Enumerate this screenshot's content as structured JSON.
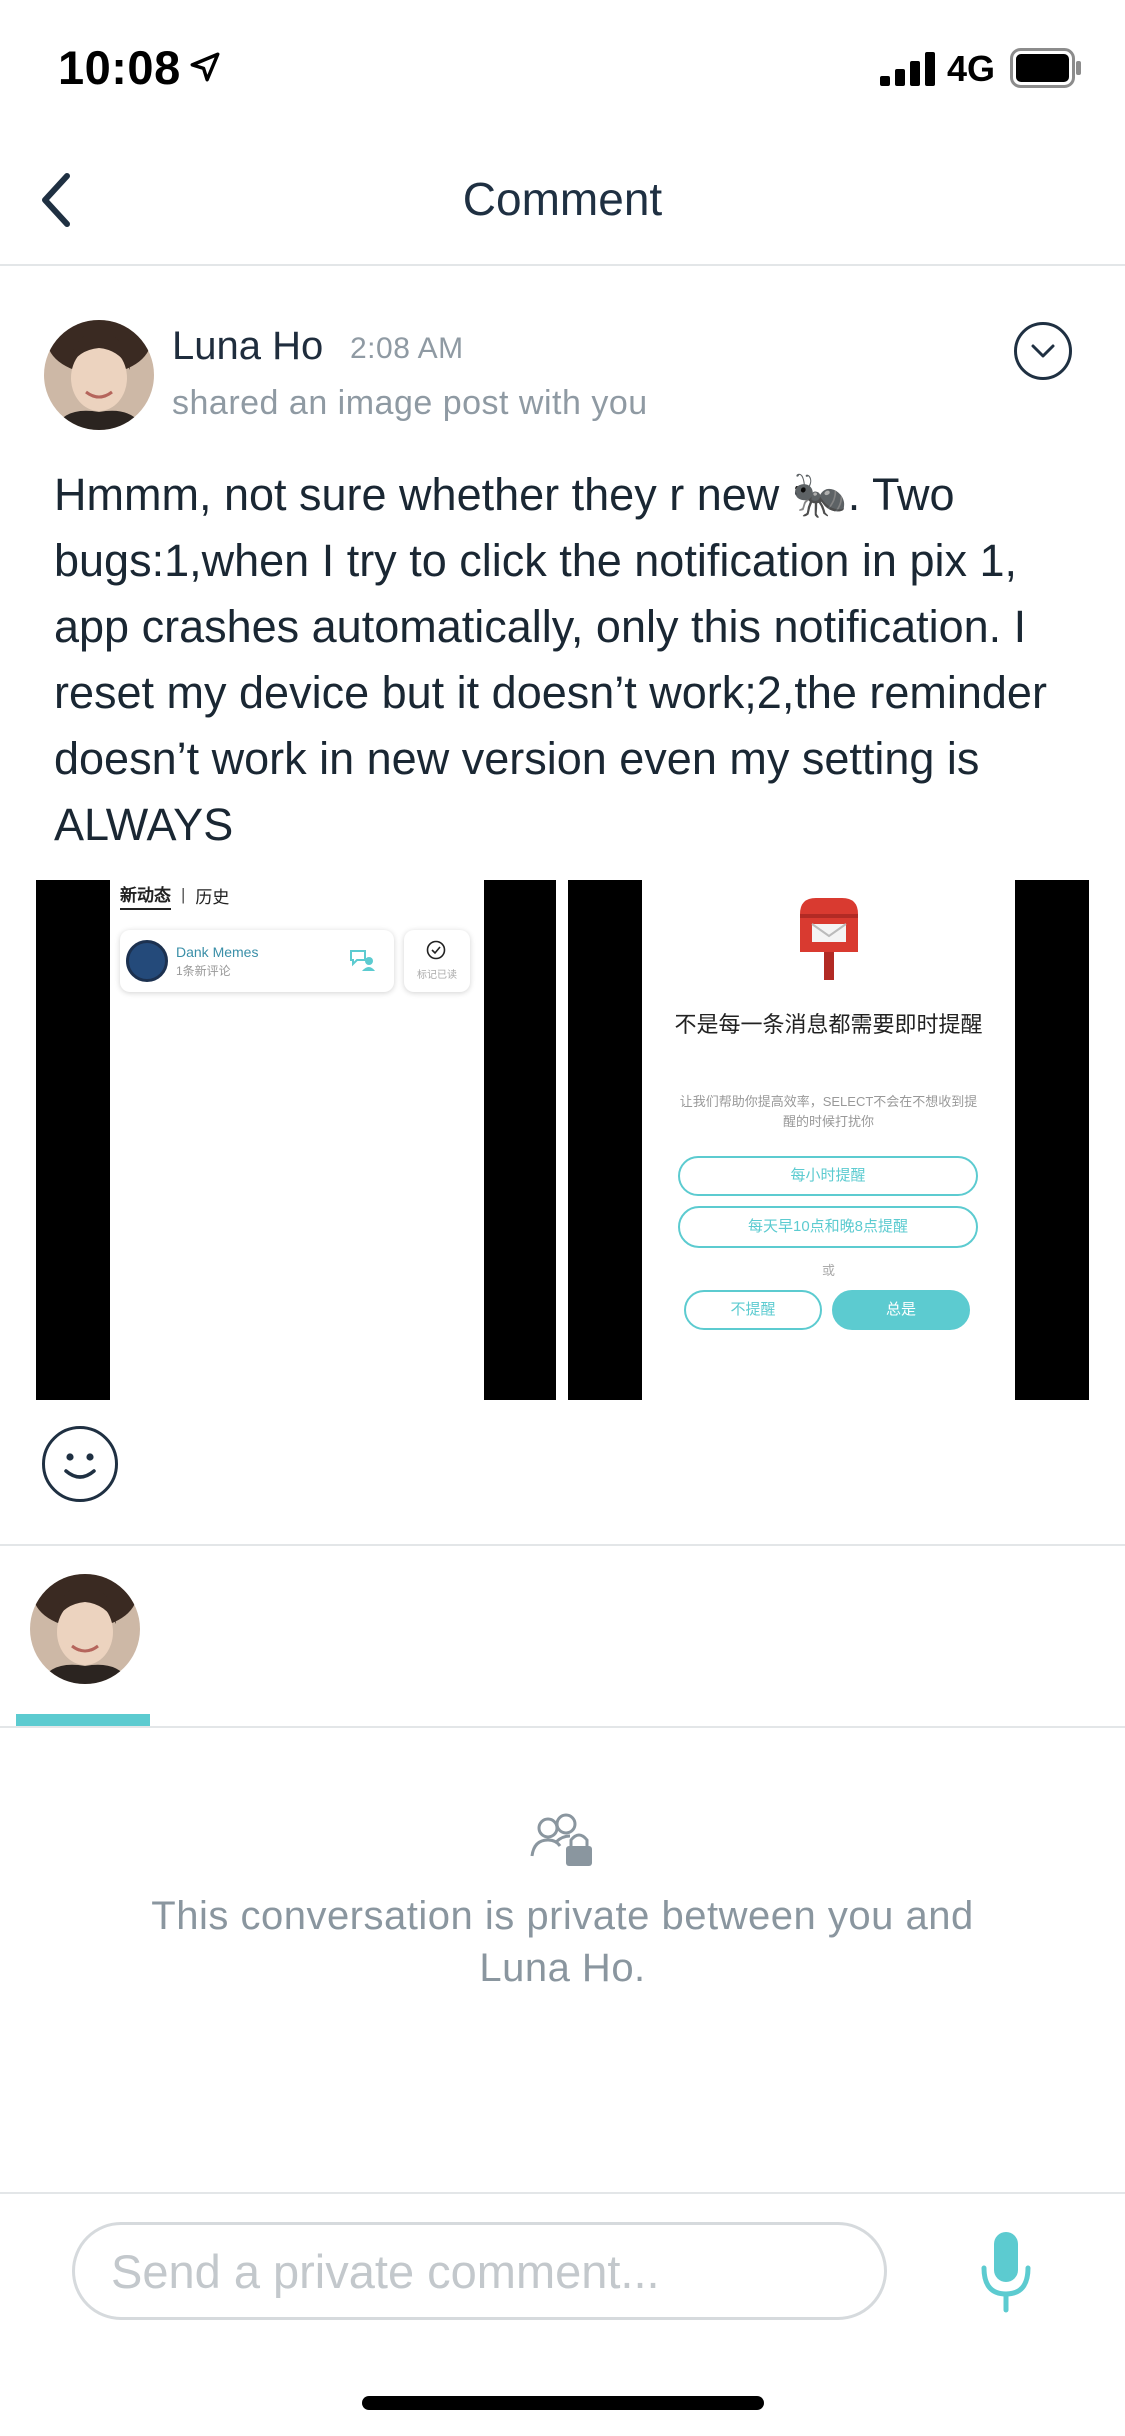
{
  "status_bar": {
    "time": "10:08",
    "network": "4G",
    "icons": [
      "location-arrow-icon",
      "signal-icon",
      "battery-icon"
    ]
  },
  "nav": {
    "title": "Comment",
    "back_icon": "chevron-left-icon"
  },
  "post": {
    "author": "Luna Ho",
    "time": "2:08 AM",
    "subtitle": "shared an image post with you",
    "body": "Hmmm, not sure whether they r new 🐜. Two bugs:1,when I try to click the notification in pix 1, app crashes automatically, only this notification. I reset my device but it doesn’t work;2,the reminder doesn’t work in new version even my setting is ALWAYS",
    "menu_icon": "chevron-down-circle-icon",
    "images": [
      {
        "tabs": [
          "新动态",
          "历史"
        ],
        "notification": {
          "name": "Dank Memes",
          "sub": "1条新评论"
        },
        "mark_label": "标记已读"
      },
      {
        "title": "不是每一条消息都需要即时提醒",
        "description": "让我们帮助你提高效率，SELECT不会在不想收到提醒的时候打扰你",
        "option_hourly": "每小时提醒",
        "option_daily": "每天早10点和晚8点提醒",
        "or": "或",
        "option_never": "不提醒",
        "option_always": "总是"
      }
    ],
    "reaction_icon": "smiley-face-icon"
  },
  "conversation": {
    "privacy_text": "This conversation is private between you and Luna Ho.",
    "privacy_icon": "users-lock-icon"
  },
  "composer": {
    "placeholder": "Send a private comment...",
    "value": "",
    "mic_icon": "microphone-icon"
  },
  "colors": {
    "accent": "#5ccbd0",
    "text_dark": "#1f3042",
    "text_muted": "#8a969f"
  }
}
